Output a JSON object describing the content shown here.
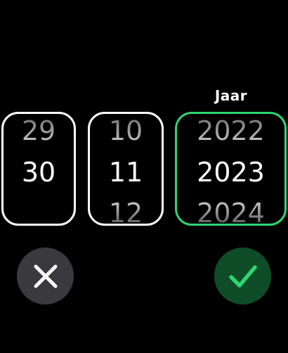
{
  "year_label": "Jaar",
  "pickers": {
    "day": {
      "prev": "29",
      "current": "30",
      "next": ""
    },
    "month": {
      "prev": "10",
      "current": "11",
      "next": "12"
    },
    "year": {
      "prev": "2022",
      "current": "2023",
      "next": "2024"
    }
  },
  "colors": {
    "background": "#000000",
    "selected_border": "#2ed573",
    "confirm_button_bg": "#0f4d28",
    "confirm_check": "#2ed573",
    "cancel_button_bg": "#3a3a3e"
  },
  "icons": {
    "cancel": "close-icon",
    "confirm": "checkmark-icon"
  }
}
